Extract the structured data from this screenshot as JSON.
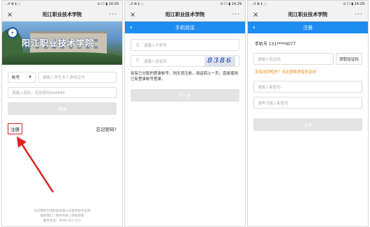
{
  "status": {
    "left": "‥il ⊗ ‡ ◌",
    "right": "⊙ ☐ ▮ 14:29"
  },
  "window": {
    "close": "×",
    "title": "阳江职业技术学院",
    "more": "···"
  },
  "login": {
    "school_name": "阳江职业技术学院",
    "account_type": "帐号",
    "account_placeholder": "请输入学生本人身份证号",
    "password_placeholder": "请输入密码，初始密码666666",
    "login_button": "登录",
    "register_link": "注册",
    "forgot_link": "忘记密码?",
    "footer_line1": "北京网新在线科技有限公司提供技术支持",
    "footer_line2": "联系我们 | 服务条款 | 隐私政策",
    "footer_line3": "服务电话：4006-511-512"
  },
  "verify": {
    "back": "‹",
    "title": "手机验证",
    "phone_placeholder": "请输入手机号",
    "code_placeholder": "请输入验证码",
    "captcha_text": "8386",
    "hint": "如有已分配的登录帐号，则无须注册，请返回上一页，直接使用已有登录帐号登录。",
    "next_button": "下一步"
  },
  "register": {
    "back": "‹",
    "title": "注册",
    "phone_label": "手机号 131****0077",
    "code_placeholder": "请输入验证码",
    "get_code": "获取验证码",
    "no_code_hint": "没有收到短信？点此获取语音验证码",
    "new_password_placeholder": "请输入新密码",
    "repeat_password_placeholder": "请再次输入新密码",
    "register_button": "注册"
  },
  "icons": {
    "phone": "phone-icon",
    "shield": "shield-icon",
    "caret": "caret-down-icon"
  },
  "colors": {
    "accent": "#1e8cf0",
    "highlight": "#e02020",
    "hint_orange": "#e8850c"
  }
}
